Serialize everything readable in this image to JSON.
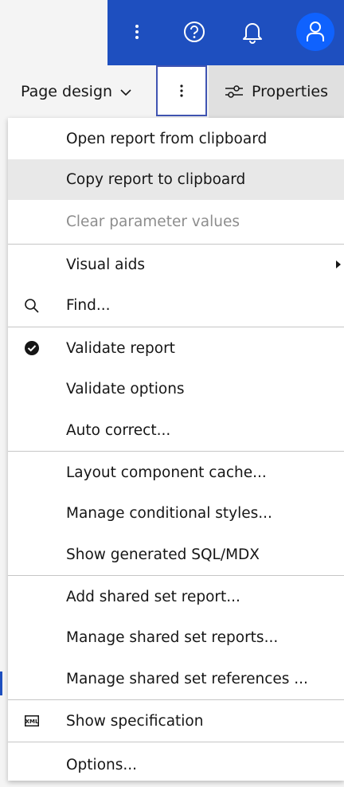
{
  "header": {
    "icons": [
      "overflow-menu-icon",
      "help-icon",
      "notification-icon",
      "user-icon"
    ],
    "brand_color": "#1e4fbf",
    "avatar_color": "#0f62fe"
  },
  "toolbar": {
    "page_design_label": "Page design",
    "properties_label": "Properties"
  },
  "menu": {
    "groups": [
      {
        "items": [
          {
            "label": "Open report from clipboard",
            "state": "normal"
          },
          {
            "label": "Copy report to clipboard",
            "state": "hover"
          },
          {
            "label": "Clear parameter values",
            "state": "disabled"
          }
        ]
      },
      {
        "items": [
          {
            "label": "Visual aids",
            "submenu": true
          },
          {
            "label": "Find...",
            "icon": "search-icon"
          }
        ]
      },
      {
        "items": [
          {
            "label": "Validate report",
            "icon": "checkmark-filled-icon"
          },
          {
            "label": "Validate options"
          },
          {
            "label": "Auto correct..."
          }
        ]
      },
      {
        "items": [
          {
            "label": "Layout component cache..."
          },
          {
            "label": "Manage conditional styles..."
          },
          {
            "label": "Show generated SQL/MDX"
          }
        ]
      },
      {
        "items": [
          {
            "label": "Add shared set report..."
          },
          {
            "label": "Manage shared set reports..."
          },
          {
            "label": "Manage shared set references ..."
          }
        ]
      },
      {
        "items": [
          {
            "label": "Show specification",
            "icon": "xml-icon"
          }
        ]
      },
      {
        "items": [
          {
            "label": "Options..."
          }
        ]
      }
    ]
  }
}
